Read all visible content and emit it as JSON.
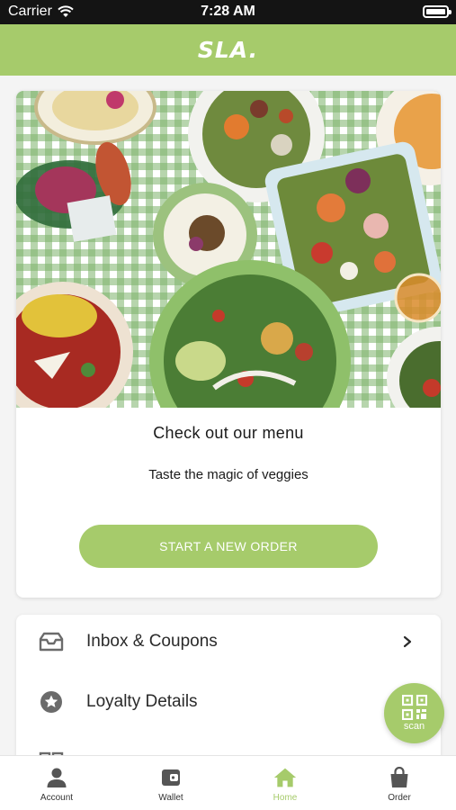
{
  "status_bar": {
    "carrier": "Carrier",
    "time": "7:28 AM"
  },
  "header": {
    "logo": "SLA."
  },
  "menu_card": {
    "title": "Check out our menu",
    "subtitle": "Taste the magic of veggies",
    "cta_label": "START A NEW ORDER"
  },
  "list": {
    "items": [
      {
        "label": "Inbox & Coupons",
        "icon": "inbox-icon"
      },
      {
        "label": "Loyalty Details",
        "icon": "star-badge-icon"
      },
      {
        "label": "",
        "icon": "grid-icon"
      }
    ]
  },
  "scan": {
    "label": "scan",
    "icon": "qr-code-icon"
  },
  "tab_bar": {
    "tabs": [
      {
        "label": "Account",
        "icon": "person-icon"
      },
      {
        "label": "Wallet",
        "icon": "wallet-icon"
      },
      {
        "label": "Home",
        "icon": "home-icon",
        "active": true
      },
      {
        "label": "Order",
        "icon": "shopping-bag-icon"
      }
    ]
  },
  "colors": {
    "brand": "#a6cb6b",
    "status_bar": "#141414",
    "text": "#1a1a1a",
    "icon_gray": "#6b6b6b"
  }
}
